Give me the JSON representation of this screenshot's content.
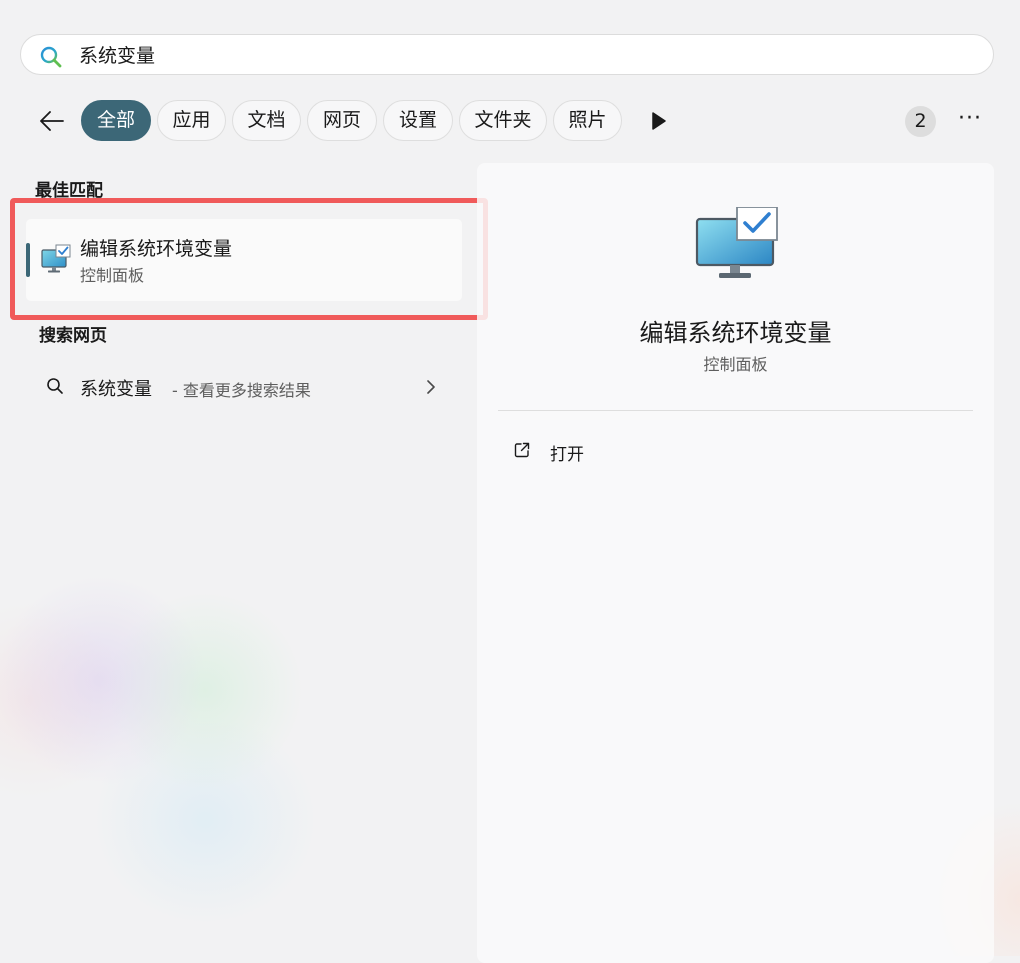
{
  "search": {
    "query": "系统变量",
    "icon": "search-icon"
  },
  "filters": {
    "back_icon": "back-arrow-icon",
    "chips": [
      "全部",
      "应用",
      "文档",
      "网页",
      "设置",
      "文件夹",
      "照片"
    ],
    "active_chip": "全部",
    "play_icon": "play-icon",
    "badge_count": "2",
    "more_label": "···"
  },
  "best_match": {
    "heading": "最佳匹配",
    "item": {
      "name": "编辑系统环境变量",
      "subtitle": "控制面板",
      "icon": "monitor-check-icon"
    }
  },
  "web_search": {
    "heading": "搜索网页",
    "item": {
      "query": "系统变量",
      "description": "- 查看更多搜索结果",
      "icon": "search-icon"
    }
  },
  "detail": {
    "icon": "monitor-check-icon",
    "title": "编辑系统环境变量",
    "subtitle": "控制面板",
    "actions": [
      {
        "label": "打开",
        "icon": "open-external-icon"
      }
    ]
  },
  "colors": {
    "accent": "#3c6777",
    "highlight": "#f05a5a"
  }
}
